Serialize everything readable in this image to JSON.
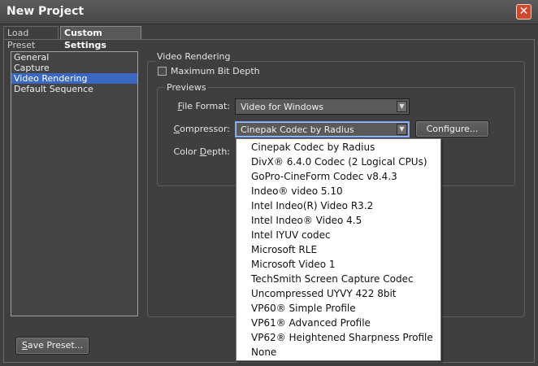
{
  "window": {
    "title": "New Project",
    "close_glyph": "✕"
  },
  "tabs": [
    {
      "label": "Load Preset",
      "active": false
    },
    {
      "label": "Custom Settings",
      "active": true
    }
  ],
  "sidebar": {
    "items": [
      {
        "label": "General",
        "selected": false
      },
      {
        "label": "Capture",
        "selected": false
      },
      {
        "label": "Video Rendering",
        "selected": true
      },
      {
        "label": "Default Sequence",
        "selected": false
      }
    ]
  },
  "video_rendering": {
    "group_title": "Video Rendering",
    "max_bit_depth": {
      "label": "Maximum Bit Depth",
      "checked": false
    },
    "previews": {
      "group_title": "Previews",
      "file_format": {
        "label_mnemonic": "F",
        "label_rest": "ile Format:",
        "value": "Video for Windows"
      },
      "compressor": {
        "label_mnemonic": "C",
        "label_rest": "ompressor:",
        "value": "Cinepak Codec by Radius"
      },
      "color_depth": {
        "label_pre": "Color ",
        "label_mnemonic": "D",
        "label_rest": "epth:"
      },
      "configure_button": "Configure..."
    }
  },
  "compressor_options": [
    "Cinepak Codec by Radius",
    "DivX® 6.4.0 Codec (2 Logical CPUs)",
    "GoPro-CineForm Codec v8.4.3",
    "Indeo® video 5.10",
    "Intel Indeo(R) Video R3.2",
    "Intel Indeo® Video 4.5",
    "Intel IYUV codec",
    "Microsoft RLE",
    "Microsoft Video 1",
    "TechSmith Screen Capture Codec",
    "Uncompressed UYVY 422 8bit",
    "VP60® Simple Profile",
    "VP61® Advanced Profile",
    "VP62® Heightened Sharpness Profile",
    "None"
  ],
  "footer": {
    "save_mnemonic": "S",
    "save_rest": "ave Preset..."
  },
  "colors": {
    "accent": "#3a67c0",
    "close": "#cd4a2e",
    "background": "#3f3f3f"
  }
}
